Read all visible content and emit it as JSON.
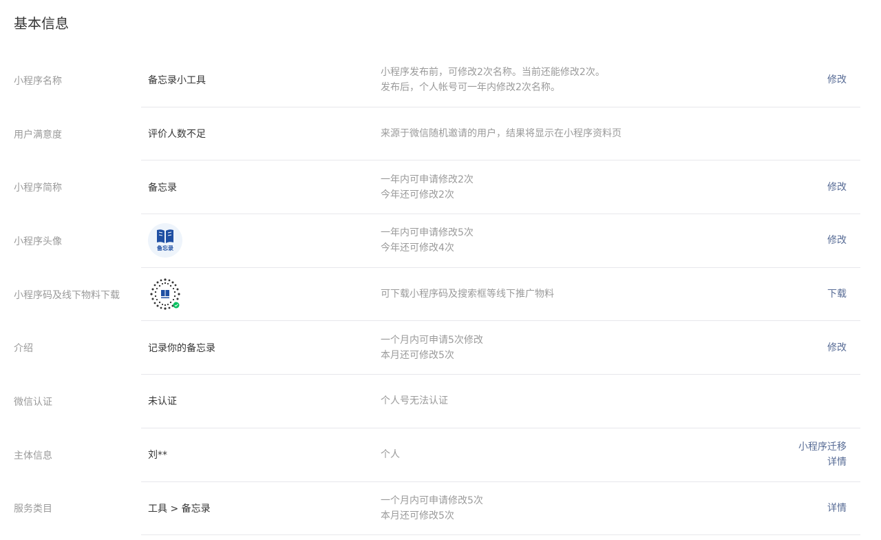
{
  "section": {
    "title": "基本信息"
  },
  "rows": [
    {
      "label": "小程序名称",
      "value": "备忘录小工具",
      "desc": [
        "小程序发布前，可修改2次名称。当前还能修改2次。",
        "发布后，个人帐号可一年内修改2次名称。"
      ],
      "actions": [
        "修改"
      ]
    },
    {
      "label": "用户满意度",
      "value": "评价人数不足",
      "desc": [
        "来源于微信随机邀请的用户，结果将显示在小程序资料页"
      ],
      "actions": []
    },
    {
      "label": "小程序简称",
      "value": "备忘录",
      "desc": [
        "一年内可申请修改2次",
        "今年还可修改2次"
      ],
      "actions": [
        "修改"
      ]
    },
    {
      "label": "小程序头像",
      "avatar_text": "备忘录",
      "desc": [
        "一年内可申请修改5次",
        "今年还可修改4次"
      ],
      "actions": [
        "修改"
      ]
    },
    {
      "label": "小程序码及线下物料下载",
      "desc": [
        "可下载小程序码及搜索框等线下推广物料"
      ],
      "actions": [
        "下载"
      ]
    },
    {
      "label": "介绍",
      "value": "记录你的备忘录",
      "desc": [
        "一个月内可申请5次修改",
        "本月还可修改5次"
      ],
      "actions": [
        "修改"
      ]
    },
    {
      "label": "微信认证",
      "value": "未认证",
      "desc": [
        "个人号无法认证"
      ],
      "actions": []
    },
    {
      "label": "主体信息",
      "value": "刘**",
      "desc": [
        "个人"
      ],
      "actions": [
        "小程序迁移",
        "详情"
      ]
    },
    {
      "label": "服务类目",
      "value": "工具 > 备忘录",
      "desc": [
        "一个月内可申请修改5次",
        "本月还可修改5次"
      ],
      "actions": [
        "详情"
      ]
    }
  ],
  "colors": {
    "link": "#576b95",
    "label": "#9a9a9a",
    "text": "#353535",
    "divider": "#e7e7eb",
    "avatar_blue": "#1f4fa3",
    "wechat_green": "#07c160"
  },
  "icons": {
    "avatar": "book-icon",
    "qrcode": "mini-program-code-icon"
  }
}
